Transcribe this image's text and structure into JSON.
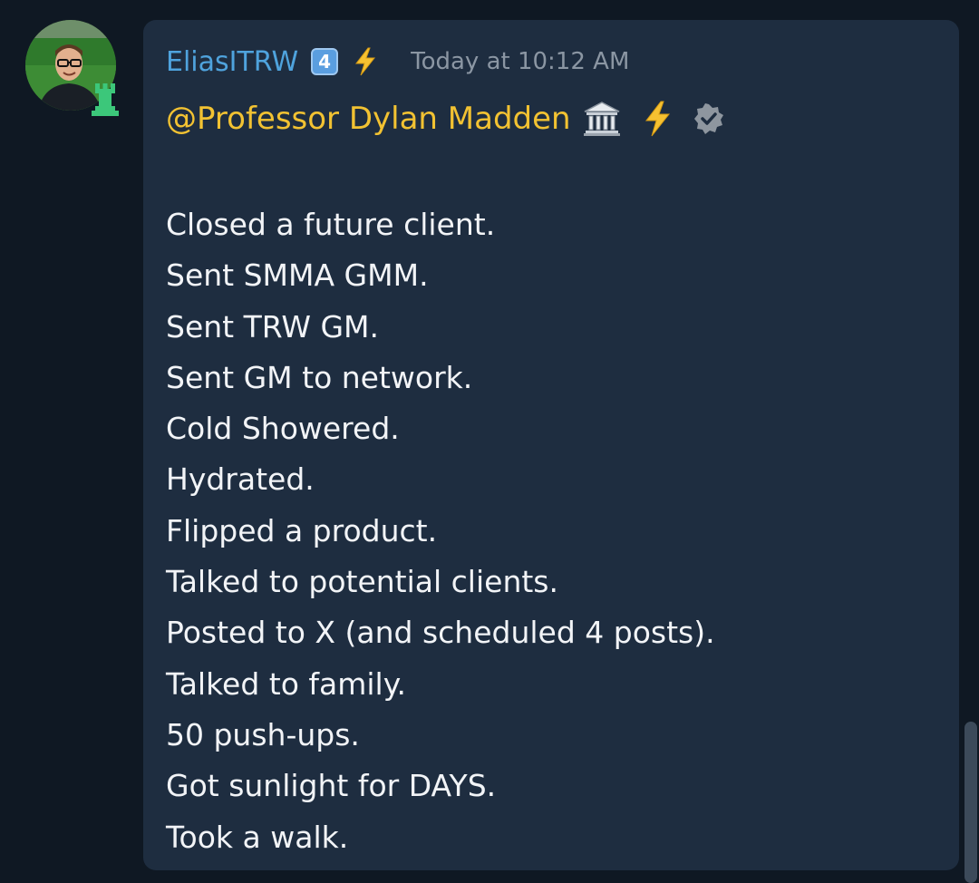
{
  "message": {
    "username": "EliasITRW",
    "level_badge": "4",
    "timestamp": "Today at 10:12 AM",
    "mention": "@Professor Dylan Madden",
    "icons": [
      "avatar",
      "rook-icon",
      "lightning-bolt-icon",
      "classical-building-icon",
      "verified-badge-icon"
    ],
    "lines": [
      {
        "text": "Closed a future client."
      },
      {
        "text": "Sent SMMA GMM."
      },
      {
        "text": "Sent TRW GM."
      },
      {
        "text": "Sent GM to network."
      },
      {
        "text": "Cold Showered."
      },
      {
        "text": "Hydrated."
      },
      {
        "text": "Flipped a product."
      },
      {
        "text": "Talked to potential clients."
      },
      {
        "text": "Posted to X (and scheduled 4 posts)."
      },
      {
        "text": "Talked to family."
      },
      {
        "text": "50 push-ups."
      },
      {
        "text": "Got sunlight for DAYS."
      },
      {
        "text": "Took a walk."
      }
    ]
  },
  "colors": {
    "background": "#0f1823",
    "bubble": "#1e2d40",
    "username": "#4fa3dd",
    "mention": "#f2c232",
    "text": "#f2f4f7",
    "timestamp": "#8b96a3",
    "rook": "#3cc77a"
  }
}
